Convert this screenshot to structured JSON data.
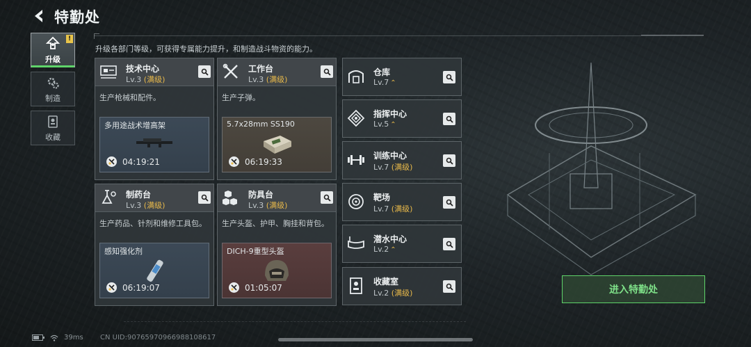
{
  "header": {
    "title": "特勤处",
    "back_icon": "back-arrow-icon"
  },
  "description": "升级各部门等级，可获得专属能力提升，和制造战斗物资的能力。",
  "side_nav": [
    {
      "label": "升级",
      "icon": "upgrade-icon",
      "active": true,
      "badge": "!"
    },
    {
      "label": "制造",
      "icon": "gear-icon",
      "active": false
    },
    {
      "label": "收藏",
      "icon": "collection-icon",
      "active": false
    }
  ],
  "departments": [
    {
      "name": "技术中心",
      "level": "Lv.3",
      "status": "(满级)",
      "desc": "生产枪械和配件。",
      "product": "多用途战术增高架",
      "timer": "04:19:21",
      "icon": "tech-center-icon"
    },
    {
      "name": "工作台",
      "level": "Lv.3",
      "status": "(满级)",
      "desc": "生产子弹。",
      "product": "5.7x28mm SS190",
      "timer": "06:19:33",
      "icon": "workbench-icon"
    },
    {
      "name": "制药台",
      "level": "Lv.3",
      "status": "(满级)",
      "desc": "生产药品、针剂和维修工具包。",
      "product": "感知强化剂",
      "timer": "06:19:07",
      "icon": "pharmacy-icon"
    },
    {
      "name": "防具台",
      "level": "Lv.3",
      "status": "(满级)",
      "desc": "生产头盔、护甲、胸挂和背包。",
      "product": "DICH-9重型头盔",
      "timer": "01:05:07",
      "icon": "armor-bench-icon"
    }
  ],
  "facilities": [
    {
      "name": "仓库",
      "level": "Lv.7",
      "status": "",
      "upgradable": true,
      "icon": "warehouse-icon"
    },
    {
      "name": "指挥中心",
      "level": "Lv.5",
      "status": "",
      "upgradable": true,
      "icon": "command-center-icon"
    },
    {
      "name": "训练中心",
      "level": "Lv.7",
      "status": "(满级)",
      "upgradable": false,
      "icon": "training-center-icon"
    },
    {
      "name": "靶场",
      "level": "Lv.7",
      "status": "(满级)",
      "upgradable": false,
      "icon": "shooting-range-icon"
    },
    {
      "name": "潜水中心",
      "level": "Lv.2",
      "status": "",
      "upgradable": true,
      "icon": "diving-center-icon"
    },
    {
      "name": "收藏室",
      "level": "Lv.2",
      "status": "(满级)",
      "upgradable": false,
      "icon": "collection-room-icon"
    }
  ],
  "enter_button": "进入特勤处",
  "footer": {
    "ping": "39ms",
    "uid": "CN UID:9076597096698810861​7"
  },
  "colors": {
    "accent_green": "#5fd46a",
    "max_level_gold": "#e8b94a"
  }
}
